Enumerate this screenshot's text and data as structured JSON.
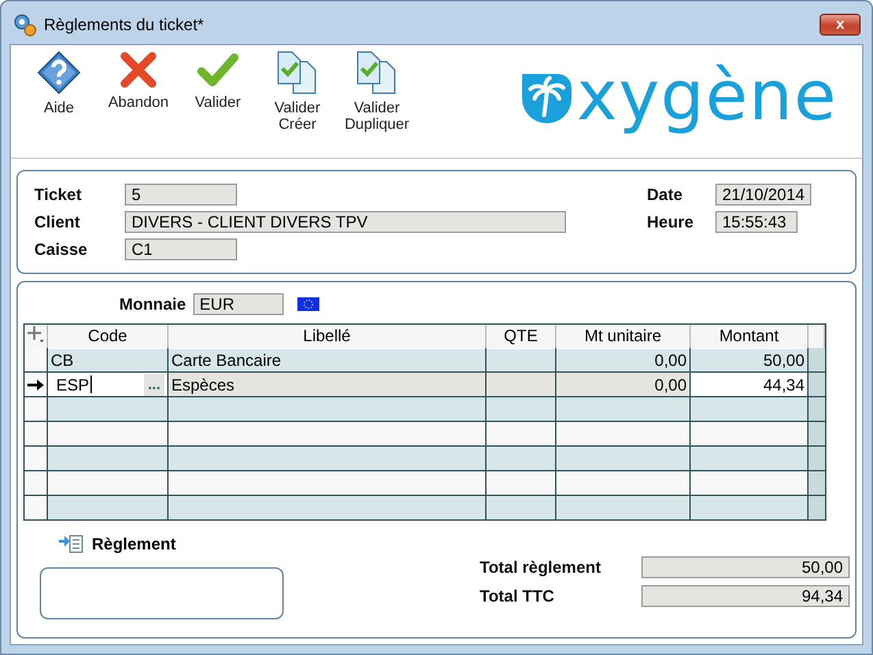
{
  "window": {
    "title": "Règlements du ticket*",
    "close_label": "x"
  },
  "toolbar": [
    {
      "kind": "help",
      "label": "Aide"
    },
    {
      "kind": "cancel",
      "label": "Abandon"
    },
    {
      "kind": "validate",
      "label": "Valider"
    },
    {
      "kind": "doc",
      "label": "Valider\nCréer"
    },
    {
      "kind": "doc",
      "label": "Valider\nDupliquer"
    }
  ],
  "logo": {
    "text": "xygène"
  },
  "header": {
    "ticket": {
      "label": "Ticket",
      "value": "5"
    },
    "client": {
      "label": "Client",
      "value": "DIVERS - CLIENT DIVERS TPV"
    },
    "caisse": {
      "label": "Caisse",
      "value": "C1"
    },
    "date": {
      "label": "Date",
      "value": "21/10/2014"
    },
    "heure": {
      "label": "Heure",
      "value": "15:55:43"
    }
  },
  "currency": {
    "label": "Monnaie",
    "value": "EUR"
  },
  "table": {
    "columns": [
      "Code",
      "Libellé",
      "QTE",
      "Mt unitaire",
      "Montant"
    ],
    "rows": [
      {
        "current": false,
        "code": "CB",
        "libelle": "Carte Bancaire",
        "mt_unitaire": "0,00",
        "montant": "50,00"
      },
      {
        "current": true,
        "code": "ESP",
        "libelle": "Espèces",
        "mt_unitaire": "0,00",
        "montant": "44,34",
        "picker": "..."
      },
      {
        "current": false
      },
      {
        "current": false
      },
      {
        "current": false
      },
      {
        "current": false
      },
      {
        "current": false
      }
    ]
  },
  "reglement_link": "Règlement",
  "totals": [
    {
      "label": "Total règlement",
      "value": "50,00"
    },
    {
      "label": "Total TTC",
      "value": "94,34"
    }
  ]
}
